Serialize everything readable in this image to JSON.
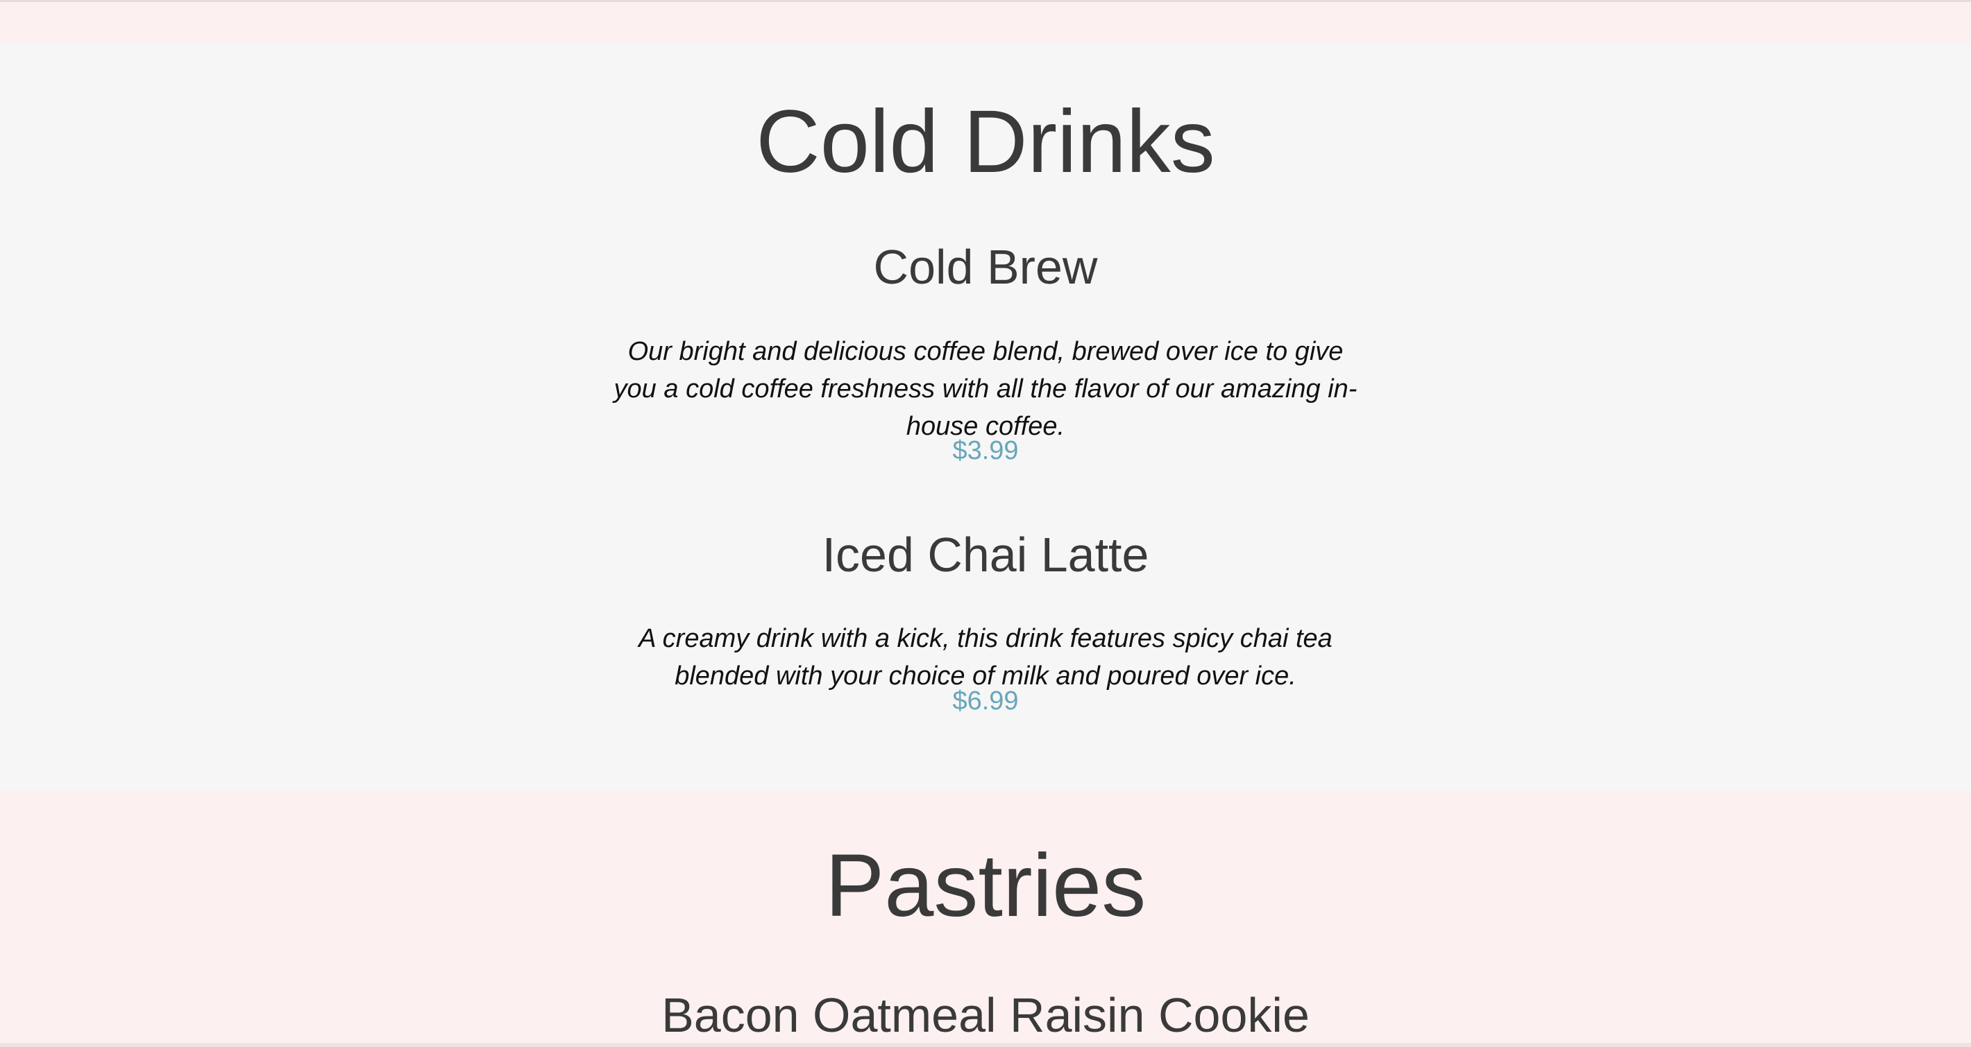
{
  "sections": [
    {
      "title": "Cold Drinks",
      "items": [
        {
          "name": "Cold Brew",
          "description": "Our bright and delicious coffee blend, brewed over ice to give you a cold coffee freshness with all the flavor of our amazing in-house coffee.",
          "price": "$3.99"
        },
        {
          "name": "Iced Chai Latte",
          "description": "A creamy drink with a kick, this drink features spicy chai tea blended with your choice of milk and poured over ice.",
          "price": "$6.99"
        }
      ]
    },
    {
      "title": "Pastries",
      "items": [
        {
          "name": "Bacon Oatmeal Raisin Cookie"
        }
      ]
    }
  ],
  "colors": {
    "section_alt_bg": "#f6f6f6",
    "section_bg": "#fcf1f0",
    "heading": "#3a3a3a",
    "description": "#111111",
    "price": "#68a6bb"
  }
}
